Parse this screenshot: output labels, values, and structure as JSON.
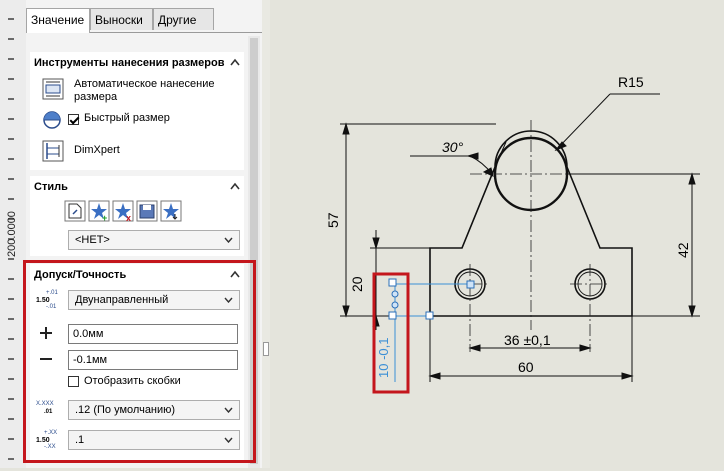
{
  "ruler": {
    "value": "200.0000"
  },
  "tabs": [
    {
      "label": "Значение",
      "active": true
    },
    {
      "label": "Выноски",
      "active": false
    },
    {
      "label": "Другие",
      "active": false
    }
  ],
  "dimension_tools": {
    "title": "Инструменты нанесения размеров",
    "auto_line1": "Автоматическое нанесение",
    "auto_line2": "размера",
    "quick_dim_label": "Быстрый размер",
    "dimxpert_label": "DimXpert"
  },
  "style": {
    "title": "Стиль",
    "select_value": "<НЕТ>"
  },
  "tolerance": {
    "title": "Допуск/Точность",
    "icon_top": "+.01",
    "icon_mid": "1.50",
    "icon_bot": "-.01",
    "type_value": "Двунаправленный",
    "upper_value": "0.0мм",
    "lower_value": "-0.1мм",
    "show_parentheses_label": "Отобразить скобки",
    "precision_value": ".12 (По умолчанию)",
    "tol_precision_value": ".1",
    "prec_icon_top": "X.XXX",
    "prec_icon_bot": ".01",
    "tprec_icon_top": "+.XX",
    "tprec_icon_mid": "1.50",
    "tprec_icon_bot": "-.XX"
  },
  "drawing": {
    "radius_label": "R15",
    "angle_label": "30°",
    "dim_57": "57",
    "dim_42": "42",
    "dim_20": "20",
    "dim_36": "36 ±0,1",
    "dim_60": "60",
    "dim_10": "10 -0,1"
  },
  "colors": {
    "highlight": "#c4161c",
    "selection": "#3a8fd6"
  }
}
